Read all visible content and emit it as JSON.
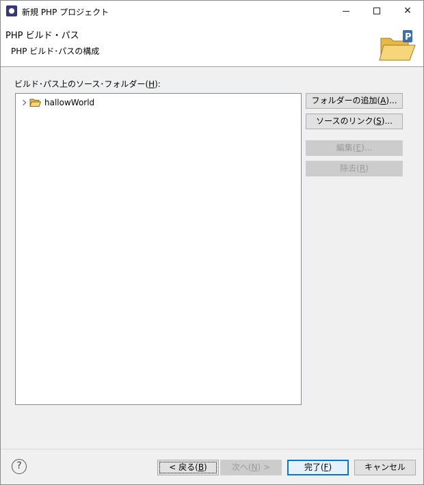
{
  "window": {
    "title": "新規 PHP プロジェクト"
  },
  "header": {
    "title": "PHP ビルド・パス",
    "description": "PHP ビルド･パスの構成",
    "image_icon": "php-folder-wizard-icon"
  },
  "section": {
    "label_prefix": "ビルド･パス上のソース･フォルダー(",
    "label_mnemonic": "H",
    "label_suffix": "):"
  },
  "tree": {
    "items": [
      {
        "label": "hallowWorld",
        "icon": "open-folder-icon",
        "expanded": false
      }
    ]
  },
  "side_buttons": {
    "add_folder": {
      "prefix": "フォルダーの追加(",
      "mnemonic": "A",
      "suffix": ")..."
    },
    "link_source": {
      "prefix": "ソースのリンク(",
      "mnemonic": "S",
      "suffix": ")..."
    },
    "edit": {
      "prefix": "編集(",
      "mnemonic": "E",
      "suffix": ")..."
    },
    "remove": {
      "prefix": "除去(",
      "mnemonic": "R",
      "suffix": ")"
    }
  },
  "footer": {
    "help_glyph": "?",
    "back": {
      "prefix": "< 戻る(",
      "mnemonic": "B",
      "suffix": ")"
    },
    "next": {
      "prefix": "次へ(",
      "mnemonic": "N",
      "suffix": ") >"
    },
    "finish": {
      "prefix": "完了(",
      "mnemonic": "F",
      "suffix": ")"
    },
    "cancel": "キャンセル"
  },
  "colors": {
    "accent": "#0078d7",
    "folder": "#f5c45a",
    "php_badge": "#3f6fa8"
  }
}
